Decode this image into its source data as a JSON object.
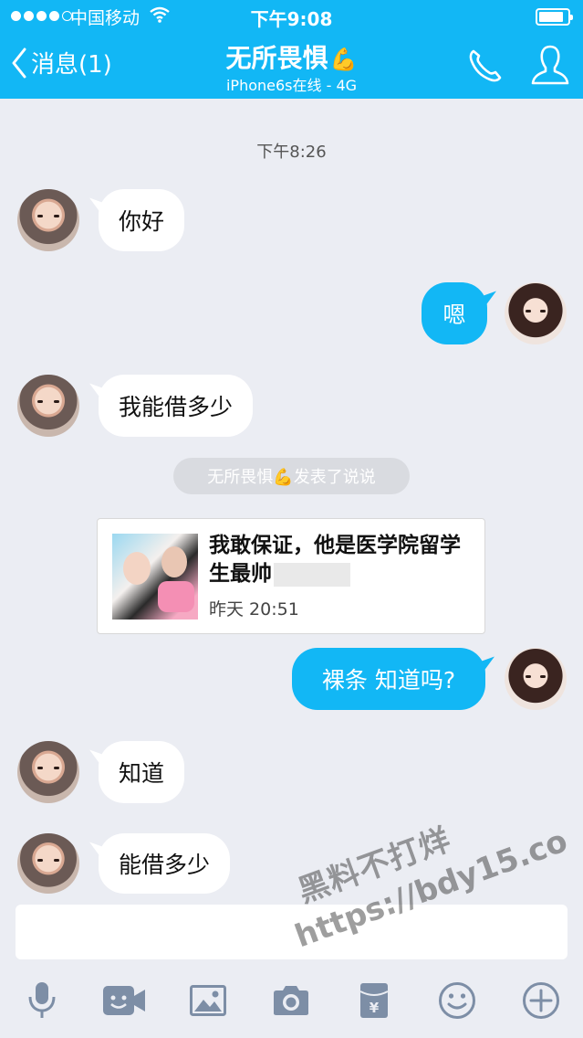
{
  "status_bar": {
    "carrier": "中国移动",
    "time": "下午9:08",
    "battery_level": 0.85
  },
  "header": {
    "back_label": "消息(1)",
    "contact_name": "无所畏惧",
    "name_emoji": "💪",
    "subtitle": "iPhone6s在线 - 4G"
  },
  "chat": {
    "time_label": "下午8:26",
    "msg1": "你好",
    "msg2": "嗯",
    "msg3": "我能借多少",
    "system_notice": "无所畏惧💪发表了说说",
    "card": {
      "text": "我敢保证，他是医学院留学生最帅",
      "date": "昨天 20:51"
    },
    "msg4": "裸条 知道吗?",
    "msg5": "知道",
    "msg6": "能借多少"
  },
  "watermark": {
    "line1": "黑料不打烊",
    "line2": "https://bdy15.co"
  },
  "icons": {
    "back": "chevron-left-icon",
    "phone": "phone-icon",
    "profile": "profile-icon",
    "toolbar": [
      "microphone-icon",
      "video-icon",
      "image-icon",
      "camera-icon",
      "red-packet-icon",
      "emoji-icon",
      "plus-icon"
    ]
  },
  "colors": {
    "accent": "#12b7f5",
    "background": "#ebedf3",
    "bubble_incoming": "#ffffff"
  }
}
